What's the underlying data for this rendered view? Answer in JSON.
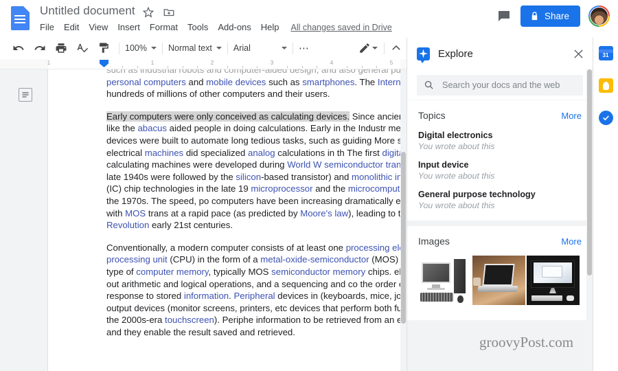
{
  "header": {
    "doc_title": "Untitled document",
    "star_icon": "star-icon",
    "move_icon": "move-to-folder-icon",
    "menus": [
      "File",
      "Edit",
      "View",
      "Insert",
      "Format",
      "Tools",
      "Add-ons",
      "Help"
    ],
    "save_status": "All changes saved in Drive",
    "comment_icon": "comment-icon",
    "share_label": "Share",
    "share_lock_icon": "lock-icon",
    "share_color": "#1a73e8",
    "avatar": "user-avatar"
  },
  "toolbar": {
    "icons": [
      "undo-icon",
      "redo-icon",
      "print-icon",
      "spellcheck-icon",
      "paint-format-icon"
    ],
    "zoom_value": "100%",
    "style_value": "Normal text",
    "font_value": "Arial",
    "more_label": "⋯",
    "edit_mode_icon": "pencil-icon",
    "collapse_icon": "chevron-up-icon"
  },
  "ruler": {
    "numbers": [
      "1",
      "1",
      "2",
      "3",
      "4",
      "5"
    ],
    "indent_marker": "indent-marker"
  },
  "document": {
    "outline_icon": "document-outline-icon",
    "paragraphs": [
      {
        "id": "p1",
        "clipped_first_line": "such as industrial robots and computer-aided design, and also general purpos",
        "html": "<span class=\"clip\">such as industrial robots and computer-aided design, and also general purpos</span><a>personal computers</a> and <a>mobile devices</a> such as <a>smartphones</a>. The <a>Internet</a> is it connects hundreds of millions of other computers and their users."
      },
      {
        "id": "p2",
        "highlighted_sentence": "Early computers were only conceived as calculating devices.",
        "html": "Since ancient tim devices like the <a>abacus</a> aided people in doing calculations. Early in the Industr mechanical devices were built to automate long tedious tasks, such as guiding More sophisticated electrical <a>machines</a> did specialized <a>analog</a> calculations in th The first <a>digital</a> electronic calculating machines were developed during <a>World W</a> <a>semiconductor transistors</a> in the late 1940s were followed by the <a>silicon</a>-based transistor) and <a>monolithic integrated circuit</a> (IC) chip technologies in the late 19 <a>microprocessor</a> and the <a>microcomputer</a> revolution in the 1970s. The speed, po computers have been increasing dramatically ever since then, with <a>MOS</a> trans at a rapid pace (as predicted by <a>Moore's law</a>), leading to the <a>Digital Revolution</a> early 21st centuries."
      },
      {
        "id": "p3",
        "html": "Conventionally, a modern computer consists of at least one <a>processing elemen</a> <a>processing unit</a> (CPU) in the form of a <a>metal-oxide-semiconductor</a> (MOS) micro some type of <a>computer memory</a>, typically MOS <a>semiconductor memory</a> chips. element carries out arithmetic and logical operations, and a sequencing and co the order of operations in response to stored <a>information</a>. <a>Peripheral</a> devices in (keyboards, mice, joystick, etc.), output devices (monitor screens, printers, etc devices that perform both functions (e.g., the 2000s-era <a>touchscreen</a>). Periphe information to be retrieved from an external source and they enable the result saved and retrieved."
      }
    ],
    "link_color": "#3c52b2",
    "selection_color": "#d4d4d4"
  },
  "explore": {
    "title": "Explore",
    "badge_icon": "explore-badge-icon",
    "close_icon": "close-icon",
    "search": {
      "icon": "search-icon",
      "placeholder": "Search your docs and the web",
      "value": ""
    },
    "topics": {
      "title": "Topics",
      "more_label": "More",
      "items": [
        {
          "name": "Digital electronics",
          "sub": "You wrote about this"
        },
        {
          "name": "Input device",
          "sub": "You wrote about this"
        },
        {
          "name": "General purpose technology",
          "sub": "You wrote about this"
        }
      ]
    },
    "images": {
      "title": "Images",
      "more_label": "More",
      "items": [
        {
          "alt": "desktop-computer-thumbnail"
        },
        {
          "alt": "laptop-on-desk-thumbnail"
        },
        {
          "alt": "imac-computer-thumbnail"
        }
      ]
    }
  },
  "rail": {
    "items": [
      {
        "name": "google-calendar-icon",
        "label": "31"
      },
      {
        "name": "google-keep-icon",
        "label": ""
      },
      {
        "name": "google-tasks-icon",
        "label": ""
      }
    ]
  },
  "watermark": {
    "text": "groovyPost.com"
  }
}
